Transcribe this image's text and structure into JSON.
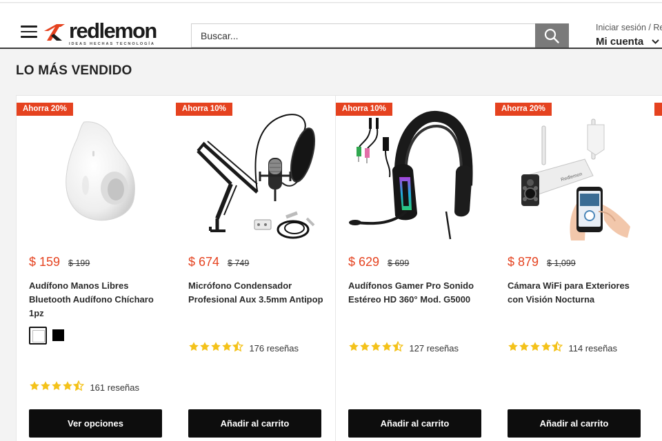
{
  "brand": {
    "name": "redlemon",
    "tagline": "IDEAS HECHAS TECNOLOGÍA",
    "accent_color": "#e5421f"
  },
  "search": {
    "placeholder": "Buscar...",
    "button_icon": "search-icon"
  },
  "account": {
    "login_text": "Iniciar sesión / Re",
    "label": "Mi cuenta",
    "icon": "chevron-down-icon"
  },
  "section": {
    "title": "LO MÁS VENDIDO"
  },
  "products": [
    {
      "badge": "Ahorra 20%",
      "price": "$ 159",
      "old_price": "$ 199",
      "name": "Audífono Manos Libres Bluetooth Audífono Chícharo 1pz",
      "swatches": [
        "white",
        "black"
      ],
      "rating": 4.5,
      "reviews": "161 reseñas",
      "cta": "Ver opciones",
      "image": "white-bluetooth-earbud"
    },
    {
      "badge": "Ahorra 10%",
      "price": "$ 674",
      "old_price": "$ 749",
      "name": "Micrófono Condensador Profesional Aux 3.5mm Antipop",
      "rating": 4.5,
      "reviews": "176 reseñas",
      "cta": "Añadir al carrito",
      "image": "condenser-microphone-arm"
    },
    {
      "badge": "Ahorra 10%",
      "price": "$ 629",
      "old_price": "$ 699",
      "name": "Audífonos Gamer Pro Sonido Estéreo HD 360° Mod. G5000",
      "rating": 4.5,
      "reviews": "127 reseñas",
      "cta": "Añadir al carrito",
      "image": "gamer-headset"
    },
    {
      "badge": "Ahorra 20%",
      "price": "$ 879",
      "old_price": "$ 1,099",
      "name": "Cámara WiFi para Exteriores con Visión Nocturna",
      "rating": 4.5,
      "reviews": "114 reseñas",
      "cta": "Añadir al carrito",
      "image": "outdoor-wifi-camera"
    }
  ]
}
